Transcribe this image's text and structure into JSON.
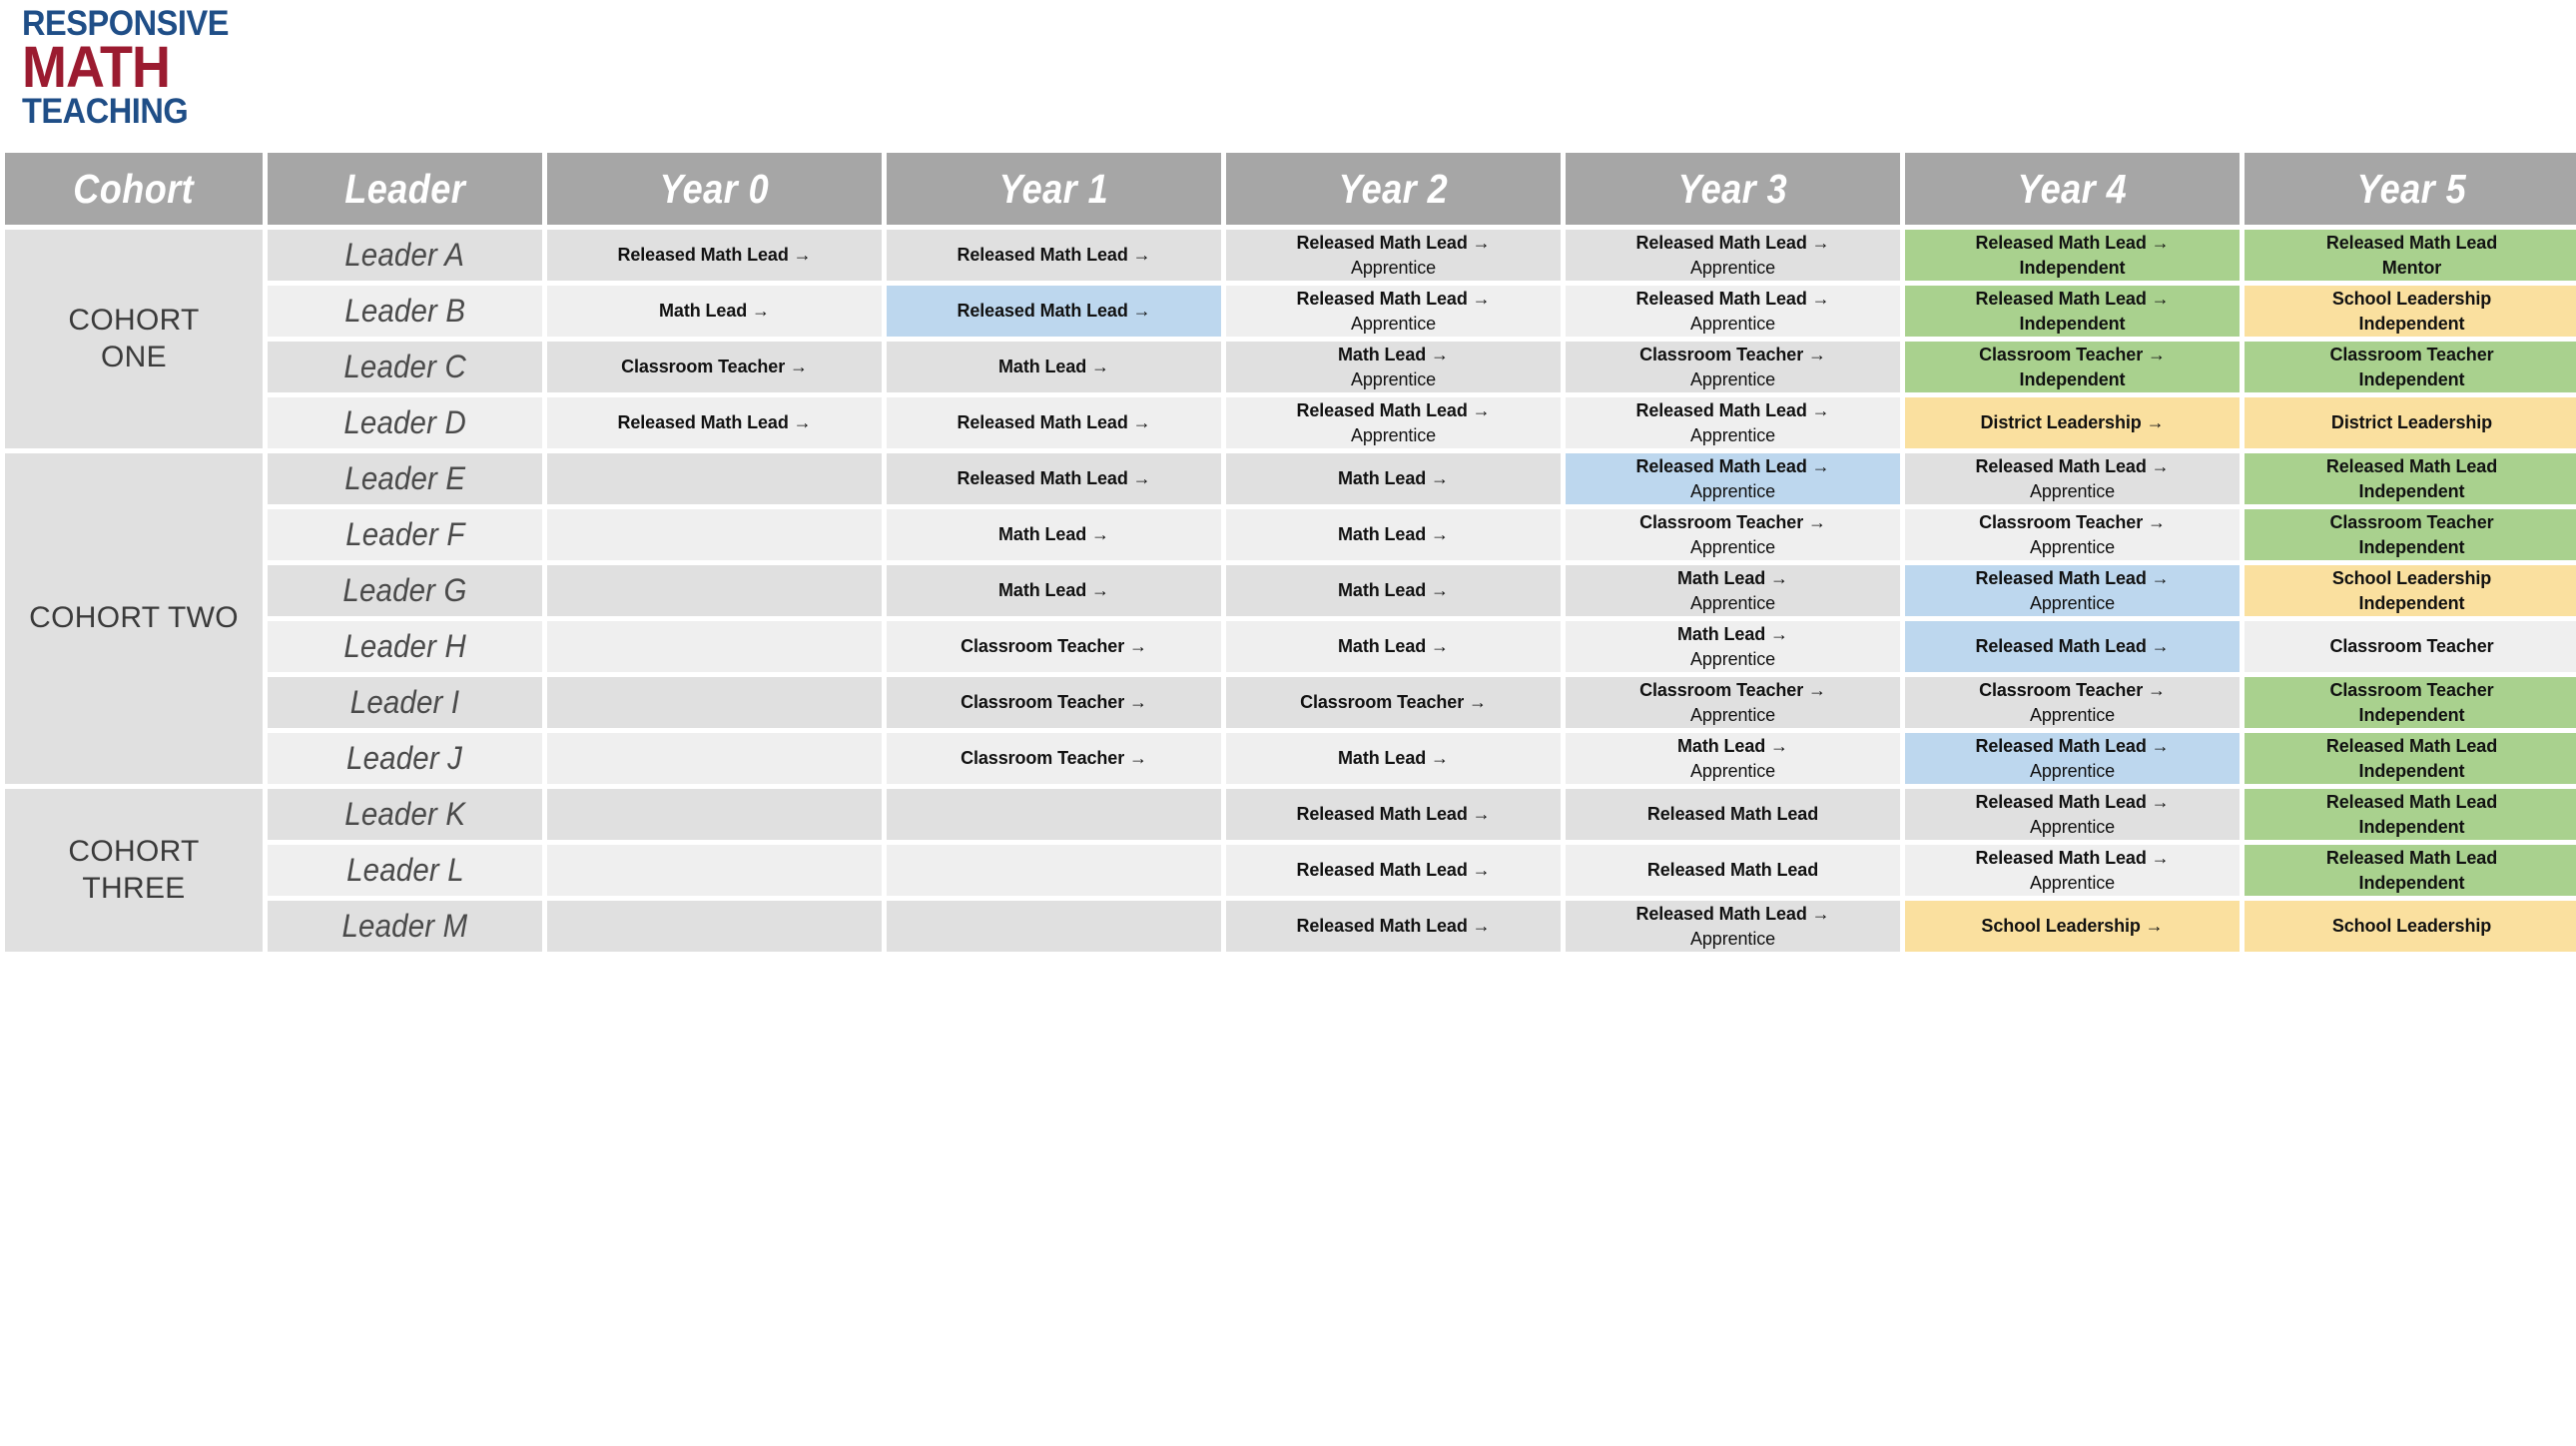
{
  "logo": {
    "line1": "RESPONSIVE",
    "line2": "MATH",
    "line3": "TEACHING",
    "color_blue": "#1f4e87",
    "color_red": "#9b1b30"
  },
  "colors": {
    "header_gray": "#a6a6a6",
    "band_dark": "#e0e0e0",
    "band_light": "#efefef",
    "green": "#a9d18e",
    "yellow": "#fae09f",
    "blue": "#bdd7ee"
  },
  "table": {
    "columns": [
      "Cohort",
      "Leader",
      "Year 0",
      "Year 1",
      "Year 2",
      "Year 3",
      "Year 4",
      "Year 5"
    ],
    "cohorts": [
      {
        "id": "cohort-one",
        "label_line1": "COHORT",
        "label_line2": "ONE"
      },
      {
        "id": "cohort-two",
        "label_line1": "COHORT TWO",
        "label_line2": ""
      },
      {
        "id": "cohort-three",
        "label_line1": "COHORT",
        "label_line2": "THREE"
      }
    ],
    "rows": [
      {
        "cohort": "cohort-one",
        "leader": "Leader A",
        "band": "dark",
        "cells": [
          {
            "ln1": "Released Math Lead →",
            "ln2": "",
            "fill": "plain"
          },
          {
            "ln1": "Released Math Lead →",
            "ln2": "",
            "fill": "plain"
          },
          {
            "ln1": "Released Math Lead →",
            "ln2": "Apprentice",
            "fill": "plain"
          },
          {
            "ln1": "Released Math Lead →",
            "ln2": "Apprentice",
            "fill": "plain"
          },
          {
            "ln1": "Released Math Lead →",
            "ln2": "Independent",
            "fill": "green"
          },
          {
            "ln1": "Released Math Lead",
            "ln2": "Mentor",
            "fill": "green"
          }
        ]
      },
      {
        "cohort": "cohort-one",
        "leader": "Leader B",
        "band": "light",
        "cells": [
          {
            "ln1": "Math Lead →",
            "ln2": "",
            "fill": "plain"
          },
          {
            "ln1": "Released Math Lead →",
            "ln2": "",
            "fill": "blue"
          },
          {
            "ln1": "Released Math Lead →",
            "ln2": "Apprentice",
            "fill": "plain"
          },
          {
            "ln1": "Released Math Lead →",
            "ln2": "Apprentice",
            "fill": "plain"
          },
          {
            "ln1": "Released Math Lead →",
            "ln2": "Independent",
            "fill": "green"
          },
          {
            "ln1": "School Leadership",
            "ln2": "Independent",
            "fill": "yellow"
          }
        ]
      },
      {
        "cohort": "cohort-one",
        "leader": "Leader C",
        "band": "dark",
        "cells": [
          {
            "ln1": "Classroom Teacher →",
            "ln2": "",
            "fill": "plain"
          },
          {
            "ln1": "Math Lead →",
            "ln2": "",
            "fill": "plain"
          },
          {
            "ln1": "Math Lead →",
            "ln2": "Apprentice",
            "fill": "plain"
          },
          {
            "ln1": "Classroom Teacher →",
            "ln2": "Apprentice",
            "fill": "plain"
          },
          {
            "ln1": "Classroom Teacher →",
            "ln2": "Independent",
            "fill": "green"
          },
          {
            "ln1": "Classroom Teacher",
            "ln2": "Independent",
            "fill": "green"
          }
        ]
      },
      {
        "cohort": "cohort-one",
        "leader": "Leader D",
        "band": "light",
        "cells": [
          {
            "ln1": "Released Math Lead →",
            "ln2": "",
            "fill": "plain"
          },
          {
            "ln1": "Released Math Lead →",
            "ln2": "",
            "fill": "plain"
          },
          {
            "ln1": "Released Math Lead →",
            "ln2": "Apprentice",
            "fill": "plain"
          },
          {
            "ln1": "Released Math Lead →",
            "ln2": "Apprentice",
            "fill": "plain"
          },
          {
            "ln1": "District Leadership →",
            "ln2": "",
            "fill": "yellow"
          },
          {
            "ln1": "District Leadership",
            "ln2": "",
            "fill": "yellow"
          }
        ]
      },
      {
        "cohort": "cohort-two",
        "leader": "Leader E",
        "band": "dark",
        "cells": [
          {
            "ln1": "",
            "ln2": "",
            "fill": "plain"
          },
          {
            "ln1": "Released Math Lead →",
            "ln2": "",
            "fill": "plain"
          },
          {
            "ln1": "Math Lead →",
            "ln2": "",
            "fill": "plain"
          },
          {
            "ln1": "Released Math Lead →",
            "ln2": "Apprentice",
            "fill": "blue"
          },
          {
            "ln1": "Released Math Lead →",
            "ln2": "Apprentice",
            "fill": "plain"
          },
          {
            "ln1": "Released Math Lead",
            "ln2": "Independent",
            "fill": "green"
          }
        ]
      },
      {
        "cohort": "cohort-two",
        "leader": "Leader F",
        "band": "light",
        "cells": [
          {
            "ln1": "",
            "ln2": "",
            "fill": "plain"
          },
          {
            "ln1": "Math Lead →",
            "ln2": "",
            "fill": "plain"
          },
          {
            "ln1": "Math Lead →",
            "ln2": "",
            "fill": "plain"
          },
          {
            "ln1": "Classroom Teacher →",
            "ln2": "Apprentice",
            "fill": "plain"
          },
          {
            "ln1": "Classroom Teacher →",
            "ln2": "Apprentice",
            "fill": "plain"
          },
          {
            "ln1": "Classroom Teacher",
            "ln2": "Independent",
            "fill": "green"
          }
        ]
      },
      {
        "cohort": "cohort-two",
        "leader": "Leader G",
        "band": "dark",
        "cells": [
          {
            "ln1": "",
            "ln2": "",
            "fill": "plain"
          },
          {
            "ln1": "Math Lead →",
            "ln2": "",
            "fill": "plain"
          },
          {
            "ln1": "Math Lead →",
            "ln2": "",
            "fill": "plain"
          },
          {
            "ln1": "Math Lead →",
            "ln2": "Apprentice",
            "fill": "plain"
          },
          {
            "ln1": "Released Math Lead →",
            "ln2": "Apprentice",
            "fill": "blue"
          },
          {
            "ln1": "School Leadership",
            "ln2": "Independent",
            "fill": "yellow"
          }
        ]
      },
      {
        "cohort": "cohort-two",
        "leader": "Leader H",
        "band": "light",
        "cells": [
          {
            "ln1": "",
            "ln2": "",
            "fill": "plain"
          },
          {
            "ln1": "Classroom Teacher →",
            "ln2": "",
            "fill": "plain"
          },
          {
            "ln1": "Math Lead →",
            "ln2": "",
            "fill": "plain"
          },
          {
            "ln1": "Math Lead →",
            "ln2": "Apprentice",
            "fill": "plain"
          },
          {
            "ln1": "Released Math Lead →",
            "ln2": "",
            "fill": "blue"
          },
          {
            "ln1": "Classroom Teacher",
            "ln2": "",
            "fill": "plain"
          }
        ]
      },
      {
        "cohort": "cohort-two",
        "leader": "Leader I",
        "band": "dark",
        "cells": [
          {
            "ln1": "",
            "ln2": "",
            "fill": "plain"
          },
          {
            "ln1": "Classroom Teacher →",
            "ln2": "",
            "fill": "plain"
          },
          {
            "ln1": "Classroom Teacher →",
            "ln2": "",
            "fill": "plain"
          },
          {
            "ln1": "Classroom Teacher →",
            "ln2": "Apprentice",
            "fill": "plain"
          },
          {
            "ln1": "Classroom Teacher →",
            "ln2": "Apprentice",
            "fill": "plain"
          },
          {
            "ln1": "Classroom Teacher",
            "ln2": "Independent",
            "fill": "green"
          }
        ]
      },
      {
        "cohort": "cohort-two",
        "leader": "Leader J",
        "band": "light",
        "cells": [
          {
            "ln1": "",
            "ln2": "",
            "fill": "plain"
          },
          {
            "ln1": "Classroom Teacher →",
            "ln2": "",
            "fill": "plain"
          },
          {
            "ln1": "Math Lead →",
            "ln2": "",
            "fill": "plain"
          },
          {
            "ln1": "Math Lead →",
            "ln2": "Apprentice",
            "fill": "plain"
          },
          {
            "ln1": "Released Math Lead →",
            "ln2": "Apprentice",
            "fill": "blue"
          },
          {
            "ln1": "Released Math Lead",
            "ln2": "Independent",
            "fill": "green"
          }
        ]
      },
      {
        "cohort": "cohort-three",
        "leader": "Leader K",
        "band": "dark",
        "cells": [
          {
            "ln1": "",
            "ln2": "",
            "fill": "plain"
          },
          {
            "ln1": "",
            "ln2": "",
            "fill": "plain"
          },
          {
            "ln1": "Released Math Lead →",
            "ln2": "",
            "fill": "plain"
          },
          {
            "ln1": "Released Math Lead",
            "ln2": "",
            "fill": "plain"
          },
          {
            "ln1": "Released Math Lead →",
            "ln2": "Apprentice",
            "fill": "plain"
          },
          {
            "ln1": "Released Math Lead",
            "ln2": "Independent",
            "fill": "green"
          }
        ]
      },
      {
        "cohort": "cohort-three",
        "leader": "Leader L",
        "band": "light",
        "cells": [
          {
            "ln1": "",
            "ln2": "",
            "fill": "plain"
          },
          {
            "ln1": "",
            "ln2": "",
            "fill": "plain"
          },
          {
            "ln1": "Released Math Lead →",
            "ln2": "",
            "fill": "plain"
          },
          {
            "ln1": "Released Math Lead",
            "ln2": "",
            "fill": "plain"
          },
          {
            "ln1": "Released Math Lead →",
            "ln2": "Apprentice",
            "fill": "plain"
          },
          {
            "ln1": "Released Math Lead",
            "ln2": "Independent",
            "fill": "green"
          }
        ]
      },
      {
        "cohort": "cohort-three",
        "leader": "Leader M",
        "band": "dark",
        "cells": [
          {
            "ln1": "",
            "ln2": "",
            "fill": "plain"
          },
          {
            "ln1": "",
            "ln2": "",
            "fill": "plain"
          },
          {
            "ln1": "Released Math Lead →",
            "ln2": "",
            "fill": "plain"
          },
          {
            "ln1": "Released Math Lead →",
            "ln2": "Apprentice",
            "fill": "plain"
          },
          {
            "ln1": "School Leadership →",
            "ln2": "",
            "fill": "yellow"
          },
          {
            "ln1": "School Leadership",
            "ln2": "",
            "fill": "yellow"
          }
        ]
      }
    ]
  }
}
